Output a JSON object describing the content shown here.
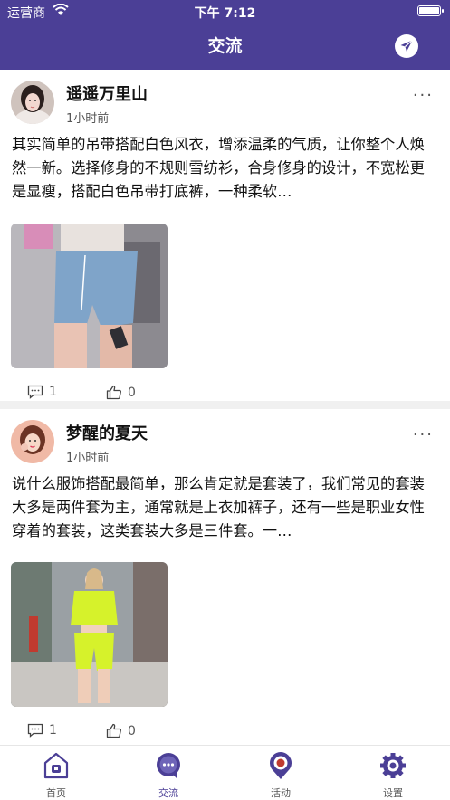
{
  "status_bar": {
    "carrier": "运营商",
    "time": "下午 7:12"
  },
  "header": {
    "title": "交流",
    "send_icon": "send-icon"
  },
  "posts": [
    {
      "username": "遥遥万里山",
      "time": "1小时前",
      "more": "···",
      "content": "其实简单的吊带搭配白色风衣，增添温柔的气质，让你整个人焕然一新。选择修身的不规则雪纺衫，合身修身的设计，不宽松更是显瘦，搭配白色吊带打底裤，一种柔软…",
      "comments": "1",
      "likes": "0"
    },
    {
      "username": "梦醒的夏天",
      "time": "1小时前",
      "more": "···",
      "content": "说什么服饰搭配最简单，那么肯定就是套装了，我们常见的套装大多是两件套为主，通常就是上衣加裤子，还有一些是职业女性穿着的套装，这类套装大多是三件套。一…",
      "comments": "1",
      "likes": "0"
    }
  ],
  "tabs": [
    {
      "label": "首页",
      "icon": "home-icon",
      "active": false
    },
    {
      "label": "交流",
      "icon": "chat-icon",
      "active": true
    },
    {
      "label": "活动",
      "icon": "location-pin-icon",
      "active": false
    },
    {
      "label": "设置",
      "icon": "gear-icon",
      "active": false
    }
  ],
  "colors": {
    "brand": "#4b3f96",
    "divider": "#f0f0f0",
    "text": "#111111",
    "muted": "#555555"
  }
}
